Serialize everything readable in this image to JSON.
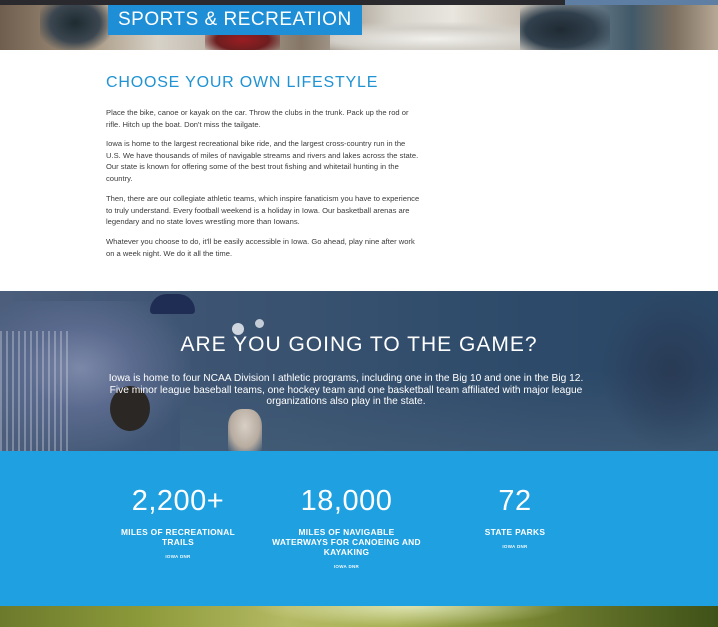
{
  "hero": {
    "title": "SPORTS & RECREATION"
  },
  "lifestyle": {
    "heading": "CHOOSE YOUR OWN LIFESTYLE",
    "paragraphs": [
      "Place the bike, canoe or kayak on the car. Throw the clubs in the trunk. Pack up the rod or rifle. Hitch up the boat. Don't miss the tailgate.",
      "Iowa is home to the largest recreational bike ride, and the largest cross-country run in the U.S. We have thousands of miles of navigable streams and rivers and lakes across the state. Our state is known for offering some of the best trout fishing and whitetail hunting in the country.",
      "Then, there are our collegiate athletic teams, which inspire fanaticism you have to experience to truly understand. Every football weekend is a holiday in Iowa. Our basketball arenas are legendary and no state loves wrestling more than Iowans.",
      "Whatever you choose to do, it'll be easily accessible in Iowa. Go ahead, play nine after work on a week night. We do it all the time."
    ]
  },
  "game": {
    "heading": "ARE YOU GOING TO THE GAME?",
    "text": "Iowa is home to four NCAA Division I athletic programs, including one in the Big 10 and one in the Big 12. Five minor league baseball teams, one hockey team and one basketball team affiliated with major league organizations also play in the state."
  },
  "stats": [
    {
      "number": "2,200+",
      "label": "MILES OF RECREATIONAL TRAILS",
      "source": "IOWA DNR"
    },
    {
      "number": "18,000",
      "label": "MILES OF NAVIGABLE WATERWAYS FOR CANOEING AND KAYAKING",
      "source": "IOWA DNR"
    },
    {
      "number": "72",
      "label": "STATE PARKS",
      "source": "IOWA DNR"
    }
  ],
  "colors": {
    "accent_blue": "#1fa0e0",
    "heading_blue": "#1f93d3",
    "game_overlay": "#35506e"
  }
}
